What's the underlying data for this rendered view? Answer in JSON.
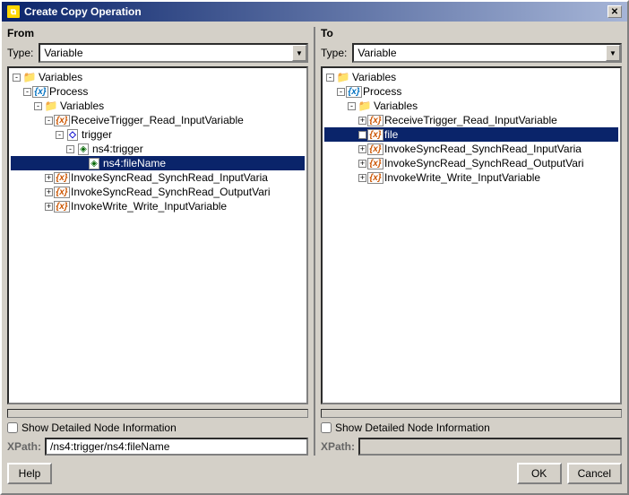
{
  "window": {
    "title": "Create Copy Operation",
    "close_label": "✕"
  },
  "from_panel": {
    "title": "From",
    "type_label": "Type:",
    "type_value": "Variable",
    "type_options": [
      "Variable"
    ],
    "show_detail_label": "Show Detailed Node Information",
    "xpath_label": "XPath:",
    "xpath_value": "/ns4:trigger/ns4:fileName",
    "tree": {
      "items": [
        {
          "id": "var-root",
          "label": "Variables",
          "indent": 0,
          "icon": "folder",
          "expand": "-"
        },
        {
          "id": "process",
          "label": "Process",
          "indent": 1,
          "icon": "tree-var",
          "expand": "-"
        },
        {
          "id": "variables2",
          "label": "Variables",
          "indent": 2,
          "icon": "folder",
          "expand": "-"
        },
        {
          "id": "receive-trigger",
          "label": "ReceiveTrigger_Read_InputVariable",
          "indent": 3,
          "icon": "var",
          "expand": "-",
          "selected": false
        },
        {
          "id": "trigger",
          "label": "trigger",
          "indent": 4,
          "icon": "element",
          "expand": "-"
        },
        {
          "id": "ns4trigger",
          "label": "ns4:trigger",
          "indent": 5,
          "icon": "element2",
          "expand": "-"
        },
        {
          "id": "ns4filename",
          "label": "ns4:fileName",
          "indent": 6,
          "icon": "element2",
          "expand": null,
          "selected": true
        },
        {
          "id": "invoke-sync-in",
          "label": "InvokeSyncRead_SynchRead_InputVaria",
          "indent": 3,
          "icon": "var",
          "expand": "+"
        },
        {
          "id": "invoke-sync-out",
          "label": "InvokeSyncRead_SynchRead_OutputVari",
          "indent": 3,
          "icon": "var",
          "expand": "+"
        },
        {
          "id": "invoke-write",
          "label": "InvokeWrite_Write_InputVariable",
          "indent": 3,
          "icon": "var",
          "expand": "+"
        }
      ]
    }
  },
  "to_panel": {
    "title": "To",
    "type_label": "Type:",
    "type_value": "Variable",
    "type_options": [
      "Variable"
    ],
    "show_detail_label": "Show Detailed Node Information",
    "xpath_label": "XPath:",
    "xpath_value": "",
    "tree": {
      "items": [
        {
          "id": "var-root-to",
          "label": "Variables",
          "indent": 0,
          "icon": "folder",
          "expand": "-"
        },
        {
          "id": "process-to",
          "label": "Process",
          "indent": 1,
          "icon": "tree-var",
          "expand": "-"
        },
        {
          "id": "variables2-to",
          "label": "Variables",
          "indent": 2,
          "icon": "folder",
          "expand": "-"
        },
        {
          "id": "receive-trigger-to",
          "label": "ReceiveTrigger_Read_InputVariable",
          "indent": 3,
          "icon": "var",
          "expand": "+"
        },
        {
          "id": "file-to",
          "label": "file",
          "indent": 3,
          "icon": "var",
          "expand": "+",
          "selected": true
        },
        {
          "id": "invoke-sync-in-to",
          "label": "InvokeSyncRead_SynchRead_InputVaria",
          "indent": 3,
          "icon": "var",
          "expand": "+"
        },
        {
          "id": "invoke-sync-out-to",
          "label": "InvokeSyncRead_SynchRead_OutputVari",
          "indent": 3,
          "icon": "var",
          "expand": "+"
        },
        {
          "id": "invoke-write-to",
          "label": "InvokeWrite_Write_InputVariable",
          "indent": 3,
          "icon": "var",
          "expand": "+"
        }
      ]
    }
  },
  "buttons": {
    "help": "Help",
    "ok": "OK",
    "cancel": "Cancel"
  }
}
